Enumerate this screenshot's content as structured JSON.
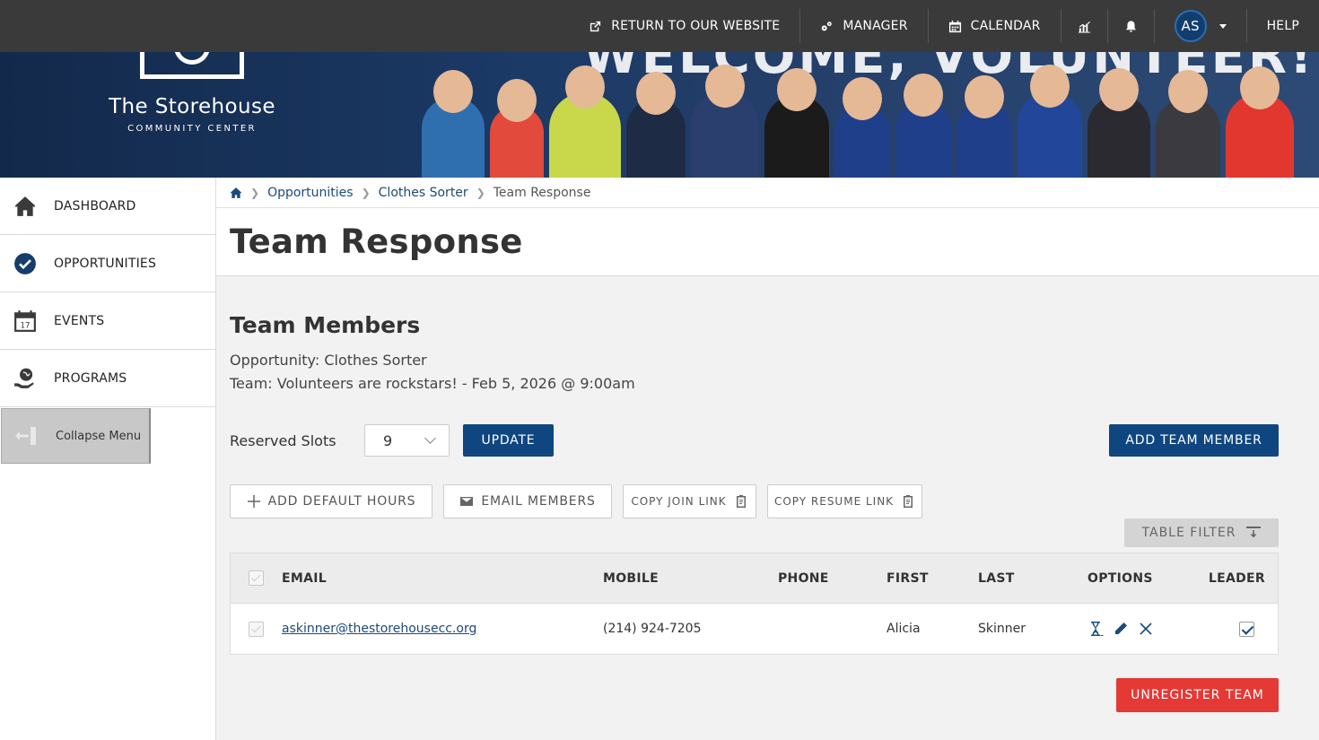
{
  "topbar": {
    "return_label": "RETURN TO OUR WEBSITE",
    "manager_label": "MANAGER",
    "calendar_label": "CALENDAR",
    "avatar_initials": "AS",
    "help_label": "HELP"
  },
  "banner": {
    "brand_name": "The Storehouse",
    "brand_sub": "COMMUNITY CENTER",
    "welcome_text": "WELCOME, VOLUNTEER!"
  },
  "sidebar": {
    "items": [
      {
        "label": "DASHBOARD",
        "icon": "home-icon"
      },
      {
        "label": "OPPORTUNITIES",
        "icon": "check-circle-icon"
      },
      {
        "label": "EVENTS",
        "icon": "calendar-17-icon"
      },
      {
        "label": "PROGRAMS",
        "icon": "globe-hand-icon"
      }
    ],
    "collapse_label": "Collapse Menu"
  },
  "breadcrumb": {
    "items": [
      "Opportunities",
      "Clothes Sorter",
      "Team Response"
    ]
  },
  "page": {
    "title": "Team Response",
    "section_title": "Team Members",
    "opportunity_line": "Opportunity: Clothes Sorter",
    "team_line": "Team: Volunteers are rockstars! - Feb 5, 2026 @ 9:00am"
  },
  "slots": {
    "label": "Reserved Slots",
    "value": "9",
    "update_label": "UPDATE",
    "add_member_label": "ADD TEAM MEMBER"
  },
  "actions": {
    "add_default_hours": "ADD DEFAULT HOURS",
    "email_members": "EMAIL MEMBERS",
    "copy_join_link": "COPY JOIN LINK",
    "copy_resume_link": "COPY RESUME LINK",
    "table_filter": "TABLE FILTER"
  },
  "table": {
    "headers": [
      "EMAIL",
      "MOBILE",
      "PHONE",
      "FIRST",
      "LAST",
      "OPTIONS",
      "LEADER"
    ],
    "rows": [
      {
        "email": "askinner@thestorehousecc.org",
        "mobile": "(214) 924-7205",
        "phone": "",
        "first": "Alicia",
        "last": "Skinner",
        "leader": true
      }
    ]
  },
  "footer": {
    "unregister_label": "UNREGISTER TEAM"
  },
  "colors": {
    "primary": "#0f4680",
    "danger": "#e53935",
    "topbar": "#3a3a3a",
    "banner": "#1b3a66"
  }
}
